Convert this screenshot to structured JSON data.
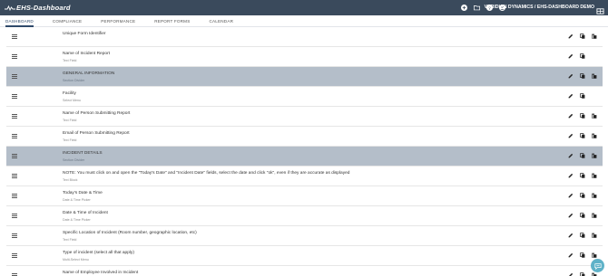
{
  "app": {
    "logo_text": "EHS-Dashboard",
    "org_label": "VERIDIAN DYNAMICS / EHS-DASHBOARD DEMO"
  },
  "colors": {
    "topbar": "#3a4a5c",
    "section_row": "#b4bec9",
    "chat_button": "#5fb2c8"
  },
  "top_icons": [
    "plus-circle-icon",
    "folder-icon",
    "help-icon",
    "account-icon",
    "grid-icon"
  ],
  "nav": {
    "tabs": [
      {
        "label": "DASHBOARD",
        "active": true
      },
      {
        "label": "COMPLIANCE"
      },
      {
        "label": "PERFORMANCE"
      },
      {
        "label": "REPORT FORMS"
      },
      {
        "label": "CALENDAR"
      }
    ]
  },
  "form_fields": [
    {
      "label": "Unique Form Identifier",
      "type": "",
      "section": false,
      "actions": [
        "edit",
        "copy",
        "delete"
      ]
    },
    {
      "label": "Name of Incident Report",
      "type": "Text Field",
      "section": false,
      "actions": [
        "edit",
        "copy"
      ]
    },
    {
      "label": "GENERAL INFORMATION",
      "type": "Section Divider",
      "section": true,
      "actions": [
        "edit",
        "copy",
        "delete"
      ]
    },
    {
      "label": "Facility",
      "type": "Select Menu",
      "section": false,
      "actions": [
        "edit",
        "copy"
      ]
    },
    {
      "label": "Name of Person Submitting Report",
      "type": "Text Field",
      "section": false,
      "actions": [
        "edit",
        "copy",
        "delete"
      ]
    },
    {
      "label": "Email of Person Submitting Report",
      "type": "Text Field",
      "section": false,
      "actions": [
        "edit",
        "copy",
        "delete"
      ]
    },
    {
      "label": "INCIDENT DETAILS",
      "type": "Section Divider",
      "section": true,
      "actions": [
        "edit",
        "copy",
        "delete"
      ]
    },
    {
      "label": "NOTE: You must click on and open the \"Today's Date\" and \"Incident Date\" fields, select the date and click \"ok\", even if they are accurate as displayed",
      "type": "Text Block",
      "section": false,
      "actions": [
        "edit",
        "copy",
        "delete"
      ]
    },
    {
      "label": "Today's Date & Time",
      "type": "Date & Time Picker",
      "section": false,
      "actions": [
        "edit",
        "copy",
        "delete"
      ]
    },
    {
      "label": "Date & Time of Incident",
      "type": "Date & Time Picker",
      "section": false,
      "actions": [
        "edit",
        "copy",
        "delete"
      ]
    },
    {
      "label": "Specific Location of Incident (Room number, geographic location, etc)",
      "type": "Text Field",
      "section": false,
      "actions": [
        "edit",
        "copy",
        "delete"
      ]
    },
    {
      "label": "Type of incident (select all that apply)",
      "type": "Multi-Select Menu",
      "section": false,
      "actions": [
        "edit",
        "copy",
        "delete"
      ]
    },
    {
      "label": "Name of Employee Involved in Incident",
      "type": "Text Field",
      "section": false,
      "actions": [
        "edit",
        "copy",
        "delete"
      ]
    }
  ]
}
